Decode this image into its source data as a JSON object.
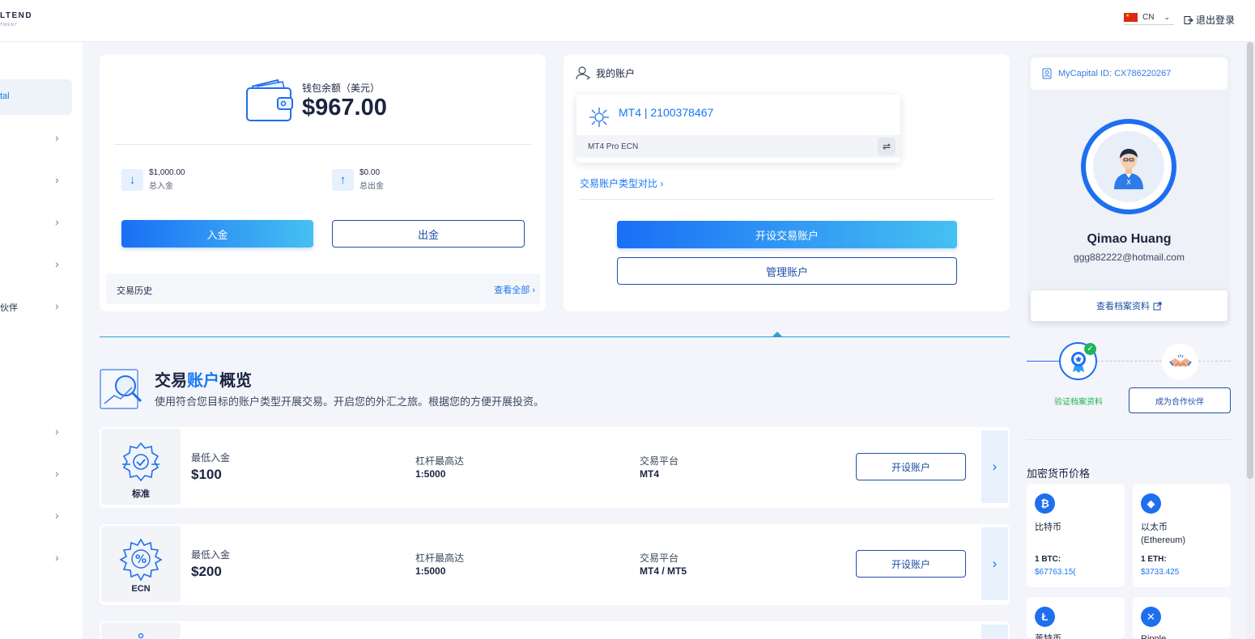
{
  "header": {
    "brand_line1": "LTEND",
    "brand_line2": "TMENT",
    "language": "CN",
    "logout": "退出登录"
  },
  "sidebar": {
    "active_item": "tal",
    "items": [
      {
        "label": ""
      },
      {
        "label": ""
      },
      {
        "label": ""
      },
      {
        "label": ""
      },
      {
        "label": "伙伴"
      },
      {
        "label": ""
      },
      {
        "label": ""
      },
      {
        "label": ""
      },
      {
        "label": ""
      }
    ]
  },
  "wallet": {
    "label": "钱包余额（美元）",
    "amount": "$967.00",
    "deposit_total": {
      "value": "$1,000.00",
      "label": "总入金"
    },
    "withdraw_total": {
      "value": "$0.00",
      "label": "总出金"
    },
    "deposit_button": "入金",
    "withdraw_button": "出金",
    "history_label": "交易历史",
    "view_all": "查看全部 ›"
  },
  "my_account": {
    "title": "我的账户",
    "account_number": "MT4 | 2100378467",
    "account_type": "MT4 Pro ECN",
    "compare_link": "交易账户类型对比 ›",
    "open_button": "开设交易账户",
    "manage_button": "管理账户"
  },
  "profile": {
    "id": "MyCapital ID: CX786220267",
    "name": "Qimao Huang",
    "email": "ggg882222@hotmail.com",
    "view_profile": "查看档案资料",
    "verify_label": "验证档案资料",
    "partner_button": "成为合作伙伴"
  },
  "overview": {
    "title_part1": "交易",
    "title_part2": "账户",
    "title_part3": "概览",
    "description": "使用符合您目标的账户类型开展交易。开启您的外汇之旅。根据您的方便开展投资。",
    "tiers": [
      {
        "name": "标准",
        "min_label": "最低入金",
        "min": "$100",
        "lev_label": "杠杆最高达",
        "lev": "1:5000",
        "plat_label": "交易平台",
        "plat": "MT4",
        "button": "开设账户"
      },
      {
        "name": "ECN",
        "min_label": "最低入金",
        "min": "$200",
        "lev_label": "杠杆最高达",
        "lev": "1:5000",
        "plat_label": "交易平台",
        "plat": "MT4 / MT5",
        "button": "开设账户"
      }
    ]
  },
  "crypto": {
    "title": "加密货币价格",
    "coins": [
      {
        "icon": "bitcoin-icon",
        "symbol": "₿",
        "name": "比特币",
        "pair": "1 BTC:",
        "price": "$67763.15("
      },
      {
        "icon": "ethereum-icon",
        "symbol": "◆",
        "name": "以太币\n(Ethereum)",
        "pair": "1 ETH:",
        "price": "$3733.425"
      },
      {
        "icon": "litecoin-icon",
        "symbol": "Ł",
        "name": "莱特币",
        "pair": "",
        "price": ""
      },
      {
        "icon": "ripple-icon",
        "symbol": "✕",
        "name": "Ripple",
        "pair": "",
        "price": ""
      }
    ]
  },
  "colors": {
    "accent": "#1877f2",
    "navy": "#1e4fa8",
    "success": "#21b35a"
  }
}
